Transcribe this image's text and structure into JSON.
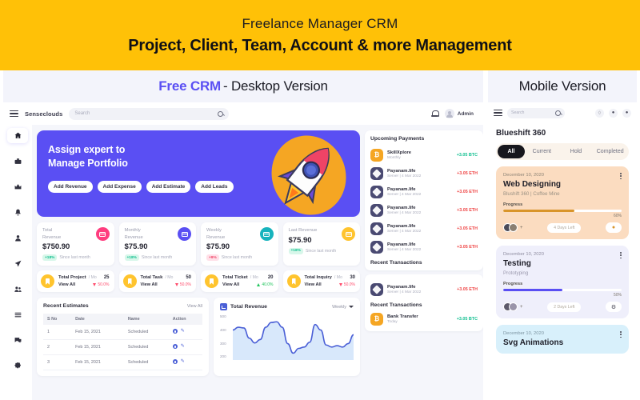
{
  "promo": {
    "title": "Freelance Manager CRM",
    "subtitle": "Project, Client, Team, Account & more Management",
    "bg_color": "#ffc107"
  },
  "version_bar": {
    "desktop_accent": "Free CRM",
    "desktop_rest": "- Desktop Version",
    "mobile_label": "Mobile Version",
    "accent_color": "#5a4ff3"
  },
  "desktop": {
    "topbar": {
      "brand": "Senseclouds",
      "search_placeholder": "Search",
      "admin_label": "Admin"
    },
    "sidebar": {
      "items": [
        {
          "name": "home",
          "glyph": "⌂"
        },
        {
          "name": "briefcase",
          "glyph": "ὋC"
        },
        {
          "name": "crown",
          "glyph": "♛"
        },
        {
          "name": "bell",
          "glyph": "ὑ4"
        },
        {
          "name": "user",
          "glyph": "☺"
        },
        {
          "name": "send",
          "glyph": "➤"
        },
        {
          "name": "team",
          "glyph": "὆5"
        },
        {
          "name": "list",
          "glyph": "≡"
        },
        {
          "name": "chat",
          "glyph": "ὊC"
        },
        {
          "name": "settings",
          "glyph": "⚙"
        }
      ]
    },
    "hero": {
      "line1": "Assign expert to",
      "line2": "Manage Portfolio",
      "buttons": [
        "Add Revenue",
        "Add Expense",
        "Add Estimate",
        "Add Leads"
      ],
      "bg_color": "#5a4ff3"
    },
    "stats": [
      {
        "label_line1": "Total",
        "label_line2": "Revenue",
        "value": "$750.90",
        "badge": "+18%",
        "badge_bg": "#d8f7ea",
        "badge_color": "#0fbf8f",
        "since": "Since last month",
        "icon_color": "#ff3d7f"
      },
      {
        "label_line1": "Monthly",
        "label_line2": "Revenue",
        "value": "$75.90",
        "badge": "+18%",
        "badge_bg": "#d8f7ea",
        "badge_color": "#0fbf8f",
        "since": "Since last month",
        "icon_color": "#5a4ff3"
      },
      {
        "label_line1": "Weekly",
        "label_line2": "Revenue",
        "value": "$75.90",
        "badge": "+9%",
        "badge_bg": "#ffe0e8",
        "badge_color": "#ef4466",
        "since": "Since last month",
        "icon_color": "#17b3bd"
      },
      {
        "label_line1": "Last",
        "label_line2": "Revenue",
        "value": "$75.90",
        "badge": "+18%",
        "badge_bg": "#d8f7ea",
        "badge_color": "#0fbf8f",
        "since": "Since last month",
        "icon_color": "#ffc42e"
      }
    ],
    "minis": [
      {
        "title": "Total Project",
        "per": "/ Mo",
        "count": "25",
        "view_all": "View All",
        "trend": "50.0%",
        "trend_dir": "down"
      },
      {
        "title": "Total Task",
        "per": "/ Mo",
        "count": "50",
        "view_all": "View All",
        "trend": "50.0%",
        "trend_dir": "down"
      },
      {
        "title": "Total Ticket",
        "per": "/ Mo",
        "count": "20",
        "view_all": "View All",
        "trend": "40.0%",
        "trend_dir": "up"
      },
      {
        "title": "Total Inquiry",
        "per": "/ Mo",
        "count": "30",
        "view_all": "View All",
        "trend": "50.0%",
        "trend_dir": "down"
      }
    ],
    "estimates": {
      "title": "Recent Estimates",
      "view_all": "View All",
      "columns": [
        "S No",
        "Date",
        "Name",
        "Action"
      ],
      "rows": [
        {
          "no": "1",
          "date": "Feb 15, 2021",
          "name": "Scheduled"
        },
        {
          "no": "2",
          "date": "Feb 15, 2021",
          "name": "Scheduled"
        },
        {
          "no": "3",
          "date": "Feb 15, 2021",
          "name": "Scheduled"
        }
      ]
    },
    "upcoming": {
      "title": "Upcoming Payments",
      "rows": [
        {
          "name": "SkillXplore",
          "sub": "Monthly",
          "amount": "+3.05 BTC",
          "dir": "up",
          "coin": "btc"
        },
        {
          "name": "Payanam.life",
          "sub": "Server | 4 Mar 2022",
          "amount": "+3.05 ETH",
          "dir": "down",
          "coin": "eth"
        },
        {
          "name": "Payanam.life",
          "sub": "Server | 4 Mar 2022",
          "amount": "+3.05 ETH",
          "dir": "down",
          "coin": "eth"
        },
        {
          "name": "Payanam.life",
          "sub": "Server | 4 Mar 2022",
          "amount": "+3.05 ETH",
          "dir": "down",
          "coin": "eth"
        },
        {
          "name": "Payanam.life",
          "sub": "Server | 4 Mar 2022",
          "amount": "+3.05 ETH",
          "dir": "down",
          "coin": "eth"
        },
        {
          "name": "Payanam.life",
          "sub": "Server | 4 Mar 2022",
          "amount": "+3.05 ETH",
          "dir": "down",
          "coin": "eth"
        }
      ],
      "section_label_partial": "Recent Transactions"
    },
    "recent_transactions": {
      "title": "Recent Transactions",
      "pre_row": {
        "name": "Payanam.life",
        "sub": "Server | 4 Mar 2022",
        "amount": "+3.05 ETH",
        "dir": "down",
        "coin": "eth"
      },
      "rows": [
        {
          "name": "Bank Transfer",
          "sub": "Today",
          "amount": "+3.05 BTC",
          "dir": "up",
          "coin": "btc"
        }
      ]
    }
  },
  "chart_data": {
    "type": "area",
    "title": "Total Revenue",
    "period_label": "Weekly",
    "ylabel": "",
    "xlabel": "",
    "ytick_labels": [
      "500",
      "400",
      "300",
      "200"
    ],
    "ylim": [
      180,
      520
    ],
    "x": [
      0,
      1,
      2,
      3,
      4,
      5,
      6,
      7,
      8,
      9,
      10,
      11,
      12,
      13,
      14,
      15,
      16,
      17
    ],
    "values": [
      400,
      420,
      415,
      340,
      305,
      330,
      420,
      455,
      460,
      420,
      300,
      230,
      265,
      275,
      310,
      440,
      400,
      290,
      275,
      285,
      275,
      300,
      365
    ],
    "line_color": "#4a5fd6",
    "fill_color": "#d8e8fb",
    "grid": false
  },
  "mobile": {
    "topbar": {
      "search_placeholder": "Search"
    },
    "title": "Blueshift 360",
    "tabs": [
      {
        "label": "All",
        "active": true
      },
      {
        "label": "Current",
        "active": false
      },
      {
        "label": "Hold",
        "active": false
      },
      {
        "label": "Completed",
        "active": false
      }
    ],
    "cards": [
      {
        "date": "December 10, 2020",
        "title": "Web Designing",
        "subtitle": "Blushift 360 | Coffee Mine",
        "progress_label": "Progress",
        "progress_pct": "60%",
        "progress_value": 60,
        "bar_color": "#d9952a",
        "pill": "4 Days Left",
        "theme": "peach",
        "action_glyph": "●"
      },
      {
        "date": "December 10, 2020",
        "title": "Testing",
        "subtitle": "Prototyping",
        "progress_label": "Progress",
        "progress_pct": "50%",
        "progress_value": 50,
        "bar_color": "#5a4ff3",
        "pill": "2 Days Left",
        "theme": "lav",
        "action_glyph": "⚙"
      },
      {
        "date": "December 10, 2020",
        "title": "Svg Animations",
        "subtitle": "",
        "progress_label": "",
        "progress_pct": "",
        "progress_value": 0,
        "bar_color": "#2196c9",
        "pill": "",
        "theme": "sky",
        "action_glyph": ""
      }
    ]
  }
}
